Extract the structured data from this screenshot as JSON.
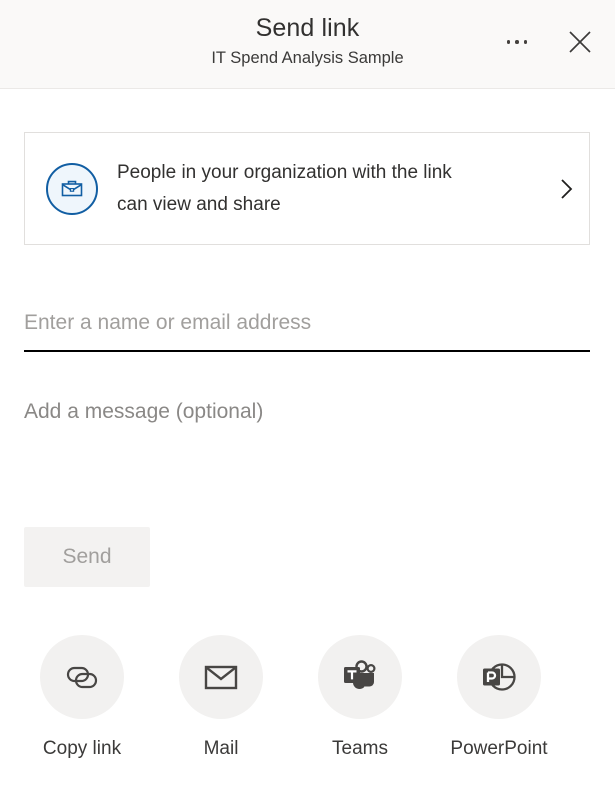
{
  "dialog": {
    "title": "Send link",
    "subtitle": "IT Spend Analysis Sample",
    "more_label": "More options",
    "more_icon": "ellipsis-icon",
    "close_label": "Close",
    "close_icon": "close-icon"
  },
  "permission": {
    "icon": "briefcase-icon",
    "line1": "People in your organization with the link",
    "line2": "can view and share",
    "chevron_icon": "chevron-right-icon",
    "accent_color": "#115ea3",
    "icon_fill": "#eff6fc"
  },
  "recipient": {
    "placeholder": "Enter a name or email address",
    "value": "",
    "underline_color": "#000000"
  },
  "message": {
    "placeholder": "Add a message (optional)",
    "value": ""
  },
  "send": {
    "label": "Send",
    "disabled": true,
    "background": "#f3f2f1",
    "text_color": "#a19f9d"
  },
  "actions": [
    {
      "label": "Copy link",
      "icon": "link-icon"
    },
    {
      "label": "Mail",
      "icon": "envelope-icon"
    },
    {
      "label": "Teams",
      "icon": "teams-icon"
    },
    {
      "label": "PowerPoint",
      "icon": "powerpoint-icon"
    }
  ]
}
